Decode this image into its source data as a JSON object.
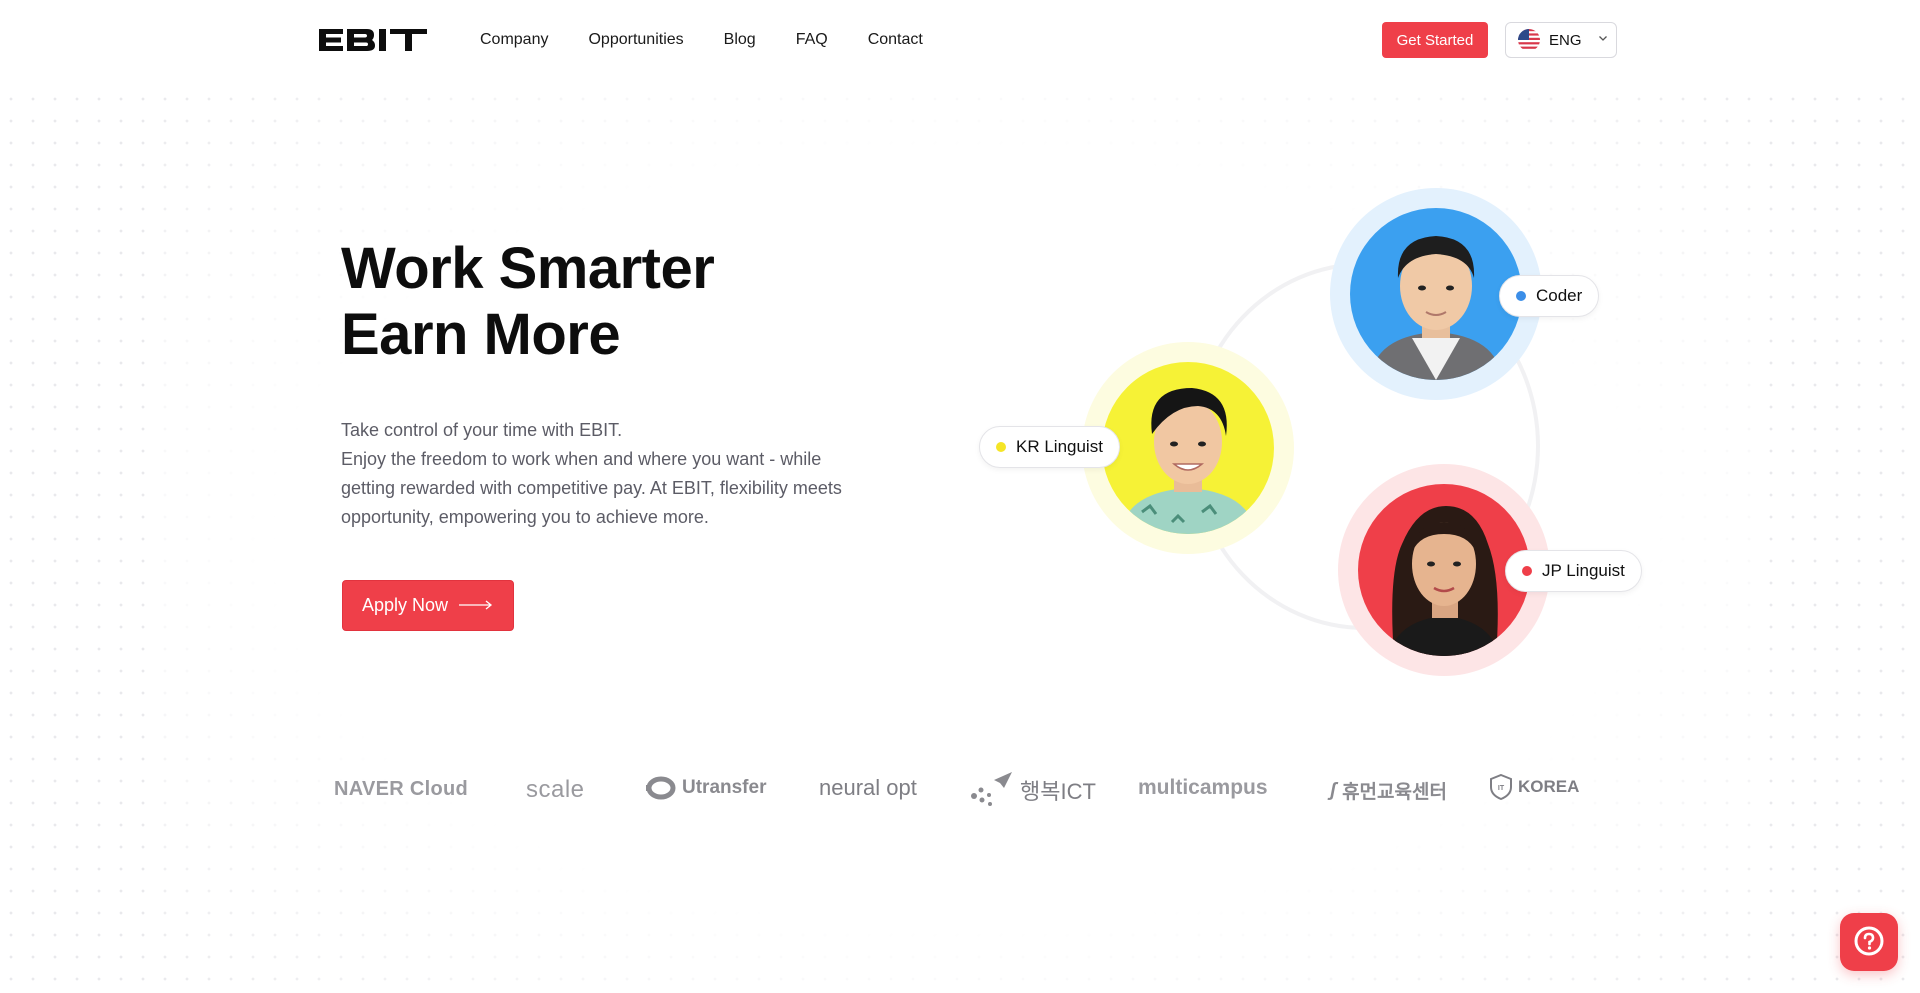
{
  "brand": {
    "logo_text": "EBIT"
  },
  "nav": {
    "links": [
      "Company",
      "Opportunities",
      "Blog",
      "FAQ",
      "Contact"
    ],
    "cta_label": "Get Started",
    "language": {
      "code": "ENG",
      "icon": "us-flag-icon"
    }
  },
  "hero": {
    "title_lines": [
      "Work Smarter",
      "Earn More"
    ],
    "description_lines": [
      "Take control of your time with EBIT.",
      "Enjoy the freedom to work when and where you want - while",
      "getting rewarded with competitive pay. At EBIT, flexibility meets",
      "opportunity, empowering you to achieve more."
    ],
    "apply_label": "Apply Now"
  },
  "profiles": [
    {
      "role": "Coder",
      "dot_color": "#3b8ee8",
      "bg_color": "#3ba0f0",
      "halo_color": "#e3f1fd"
    },
    {
      "role": "KR Linguist",
      "dot_color": "#f5e526",
      "bg_color": "#f6f236",
      "halo_color": "#fdfce0"
    },
    {
      "role": "JP Linguist",
      "dot_color": "#ef3f49",
      "bg_color": "#ef3f49",
      "halo_color": "#fde5e6"
    }
  ],
  "partners": {
    "naver": "NAVER Cloud",
    "scale": "scale",
    "utransfer": "Utransfer",
    "neural": "neural opt",
    "happy_ict": "행복ICT",
    "multicampus": "multicampus",
    "human_edu": "휴먼교육센터",
    "korea": "KOREA"
  },
  "help": {
    "icon": "question-icon"
  },
  "colors": {
    "accent": "#ef3f49",
    "text": "#111111",
    "muted": "#5c5c66"
  }
}
